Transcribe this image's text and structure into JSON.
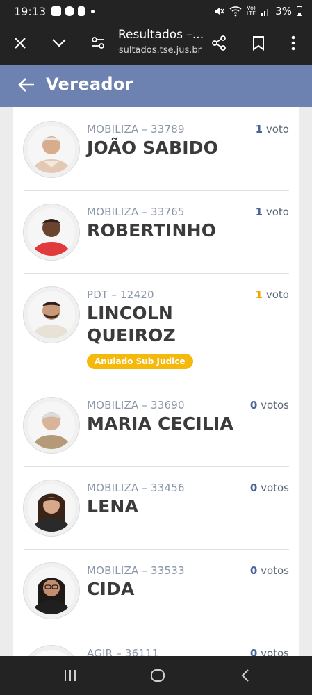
{
  "status_bar": {
    "time": "19:13",
    "battery": "3%",
    "icons": [
      "gallery-icon",
      "whatsapp-icon",
      "notification-icon",
      "mute-icon",
      "wifi-icon",
      "volte-icon",
      "signal-icon",
      "battery-icon"
    ]
  },
  "browser": {
    "page_title": "Resultados –...",
    "url": "resultados.tse.jus.br"
  },
  "header": {
    "title": "Vereador"
  },
  "candidates": [
    {
      "party_number": "MOBILIZA – 33789",
      "name_lines": [
        "JOÃO SABIDO"
      ],
      "votes_count": "1",
      "votes_label": "voto",
      "badge": ""
    },
    {
      "party_number": "MOBILIZA – 33765",
      "name_lines": [
        "ROBERTINHO"
      ],
      "votes_count": "1",
      "votes_label": "voto",
      "badge": ""
    },
    {
      "party_number": "PDT – 12420",
      "name_lines": [
        "LINCOLN",
        "QUEIROZ"
      ],
      "votes_count": "1",
      "votes_label": "voto",
      "badge": "Anulado Sub Judice"
    },
    {
      "party_number": "MOBILIZA – 33690",
      "name_lines": [
        "MARIA CECILIA"
      ],
      "votes_count": "0",
      "votes_label": "votos",
      "badge": ""
    },
    {
      "party_number": "MOBILIZA – 33456",
      "name_lines": [
        "LENA"
      ],
      "votes_count": "0",
      "votes_label": "votos",
      "badge": ""
    },
    {
      "party_number": "MOBILIZA – 33533",
      "name_lines": [
        "CIDA"
      ],
      "votes_count": "0",
      "votes_label": "votos",
      "badge": ""
    },
    {
      "party_number": "AGIR – 36111",
      "name_lines": [
        ""
      ],
      "votes_count": "0",
      "votes_label": "votos",
      "badge": ""
    }
  ],
  "colors": {
    "header_bg": "#6d82b0",
    "vote_count": "#4c6397",
    "vote_count_sub_judice": "#f0a500",
    "badge_bg": "#f5b90b"
  }
}
